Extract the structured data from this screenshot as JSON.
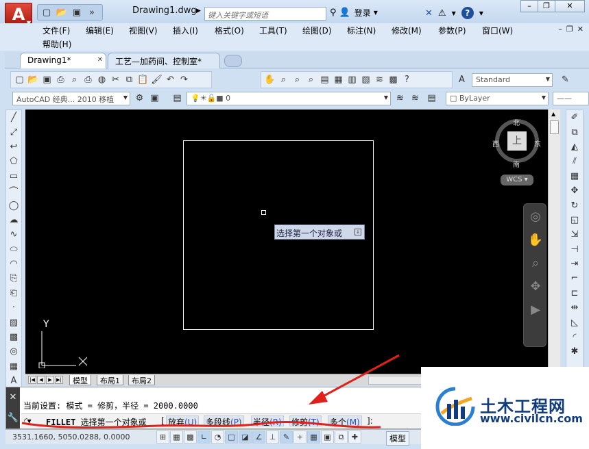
{
  "titlebar": {
    "logo": "A",
    "doc_title": "Drawing1.dwg",
    "search_placeholder": "键入关键字或短语",
    "login": "登录",
    "help": "?"
  },
  "menu": {
    "items": [
      "文件(F)",
      "编辑(E)",
      "视图(V)",
      "插入(I)",
      "格式(O)",
      "工具(T)",
      "绘图(D)",
      "标注(N)",
      "修改(M)",
      "参数(P)",
      "窗口(W)",
      "帮助(H)"
    ]
  },
  "tabs": [
    {
      "label": "Drawing1*",
      "active": true
    },
    {
      "label": "工艺—加药间、控制室*",
      "active": false
    }
  ],
  "toolbar": {
    "text_style": "Standard",
    "workspace": "AutoCAD 经典... 2010 移植",
    "layer_value": "0",
    "color_value": "ByLayer"
  },
  "viewcube": {
    "north": "北",
    "south": "南",
    "west": "西",
    "east": "东",
    "face": "上",
    "wcs": "WCS"
  },
  "canvas": {
    "tooltip": "选择第一个对象或",
    "ucs_y": "Y"
  },
  "layout_tabs": [
    "模型",
    "布局1",
    "布局2"
  ],
  "command": {
    "history": "当前设置: 模式 = 修剪，半径 = 2000.0000",
    "prompt_cmd": "FILLET",
    "prompt_text": "选择第一个对象或",
    "open_bracket": "[",
    "options": [
      {
        "label": "放弃",
        "key": "(U)"
      },
      {
        "label": "多段线",
        "key": "(P)"
      },
      {
        "label": "半径",
        "key": "(R)"
      },
      {
        "label": "修剪",
        "key": "(T)"
      },
      {
        "label": "多个",
        "key": "(M)"
      }
    ],
    "close": "]:"
  },
  "status": {
    "coords": "3531.1660, 5050.0288, 0.0000",
    "model_label": "模型"
  },
  "watermark": {
    "title": "土木工程网",
    "url": "www.civilcn.com"
  },
  "colors": {
    "canvas_bg": "#000000",
    "annotation_red": "#e0211b",
    "watermark_blue": "#123c7e"
  }
}
